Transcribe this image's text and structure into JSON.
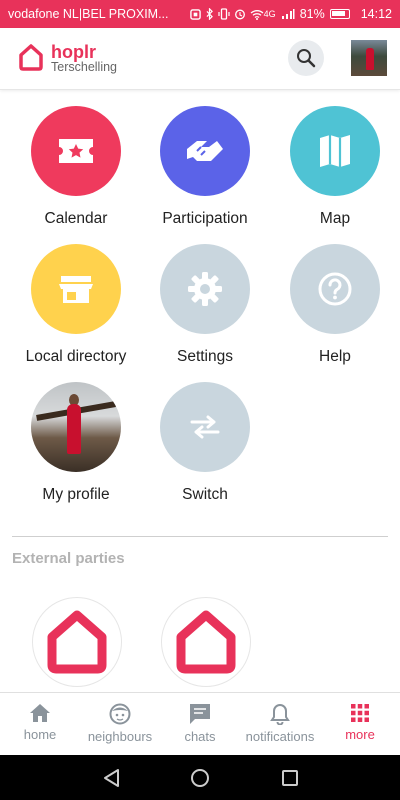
{
  "status_bar": {
    "carrier": "vodafone NL|BEL PROXIM...",
    "signal": "4G",
    "battery": "81%",
    "time": "14:12"
  },
  "header": {
    "brand": "hoplr",
    "community": "Terschelling",
    "search_icon": "search-icon"
  },
  "menu": [
    {
      "label": "Calendar",
      "icon": "ticket-star-icon",
      "color": "#ef3a5d"
    },
    {
      "label": "Participation",
      "icon": "handshake-icon",
      "color": "#5b63e8"
    },
    {
      "label": "Map",
      "icon": "map-icon",
      "color": "#4fc3d4"
    },
    {
      "label": "Local directory",
      "icon": "store-icon",
      "color": "#ffd24d"
    },
    {
      "label": "Settings",
      "icon": "gear-icon",
      "color": "#c9d6de"
    },
    {
      "label": "Help",
      "icon": "help-icon",
      "color": "#c9d6de"
    },
    {
      "label": "My profile",
      "icon": "profile-photo",
      "color": "#c9d6de"
    },
    {
      "label": "Switch",
      "icon": "swap-icon",
      "color": "#c9d6de"
    }
  ],
  "external": {
    "title": "External parties"
  },
  "nav": [
    {
      "label": "home",
      "icon": "home-icon",
      "active": false
    },
    {
      "label": "neighbours",
      "icon": "face-icon",
      "active": false
    },
    {
      "label": "chats",
      "icon": "chat-icon",
      "active": false
    },
    {
      "label": "notifications",
      "icon": "bell-icon",
      "active": false
    },
    {
      "label": "more",
      "icon": "grid-icon",
      "active": true
    }
  ],
  "colors": {
    "accent": "#e8325a",
    "muted_circle": "#c9d6de",
    "nav_inactive": "#8a939b"
  }
}
